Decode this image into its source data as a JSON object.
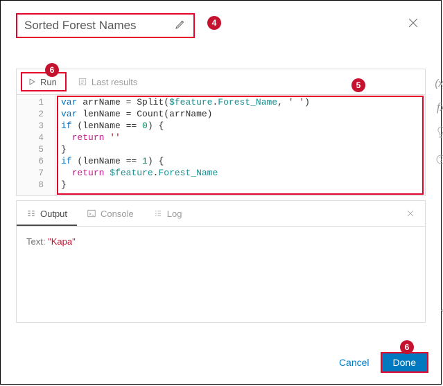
{
  "title": "Sorted Forest Names",
  "toolbar": {
    "run": "Run",
    "last_results": "Last results"
  },
  "code": {
    "line_numbers": [
      "1",
      "2",
      "3",
      "4",
      "5",
      "6",
      "7",
      "8"
    ],
    "l1": {
      "kw": "var",
      "id": "arrName",
      "fn": "Split",
      "feat": "$feature",
      "prop": "Forest_Name",
      "str": "' '"
    },
    "l2": {
      "kw": "var",
      "id": "lenName",
      "fn": "Count",
      "arg": "arrName"
    },
    "l3": {
      "kw": "if",
      "cond_a": "lenName",
      "num": "0"
    },
    "l4": {
      "ret": "return",
      "str": "''"
    },
    "l5": {
      "brace": "}"
    },
    "l6": {
      "kw": "if",
      "cond_a": "lenName",
      "num": "1"
    },
    "l7": {
      "ret": "return",
      "feat": "$feature",
      "prop": "Forest_Name"
    },
    "l8": {
      "brace": "}"
    }
  },
  "rail": {
    "vars": "(x)",
    "fx": "fx"
  },
  "results": {
    "tab_output": "Output",
    "tab_console": "Console",
    "tab_log": "Log",
    "text_lbl": "Text:",
    "text_val": "\"Kapa\""
  },
  "footer": {
    "cancel": "Cancel",
    "done": "Done"
  },
  "callouts": {
    "c4": "4",
    "c5": "5",
    "c6a": "6",
    "c6b": "6"
  }
}
